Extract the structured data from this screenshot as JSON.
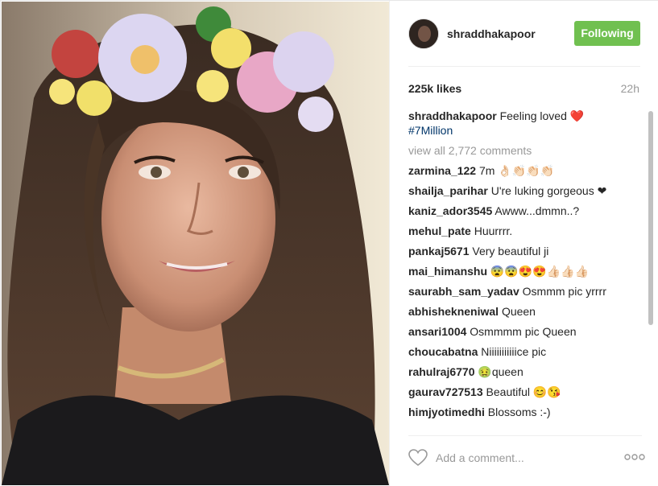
{
  "post": {
    "username": "shraddhakapoor",
    "follow_label": "Following",
    "likes": "225k likes",
    "time": "22h",
    "caption_author": "shraddhakapoor",
    "caption_text": "Feeling loved",
    "caption_heart": "❤️",
    "caption_hashtag": "#7Million",
    "view_all": "view all 2,772 comments"
  },
  "comments": [
    {
      "author": "zarmina_122",
      "text": "7m 👌🏻👏🏻👏🏻👏🏻"
    },
    {
      "author": "shailja_parihar",
      "text": "U're luking gorgeous ❤"
    },
    {
      "author": "kaniz_ador3545",
      "text": "Awww...dmmn..?"
    },
    {
      "author": "mehul_pate",
      "text": "Huurrrr."
    },
    {
      "author": "pankaj5671",
      "text": "Very beautiful ji"
    },
    {
      "author": "mai_himanshu",
      "text": "😨😨😍😍👍🏻👍🏻👍🏻"
    },
    {
      "author": "saurabh_sam_yadav",
      "text": "Osmmm pic yrrrr"
    },
    {
      "author": "abhishekneniwal",
      "text": "Queen"
    },
    {
      "author": "ansari1004",
      "text": "Osmmmm pic Queen"
    },
    {
      "author": "choucabatna",
      "text": "Niiiiiiiiiiice pic"
    },
    {
      "author": "rahulraj6770",
      "text": "🤢queen"
    },
    {
      "author": "gaurav727513",
      "text": "Beautiful 😊😘"
    },
    {
      "author": "himjyotimedhi",
      "text": "Blossoms :-)"
    }
  ],
  "footer": {
    "comment_placeholder": "Add a comment...",
    "more_label": "ooo"
  },
  "icons": {
    "like": "heart-outline-icon",
    "more": "ellipsis-icon"
  },
  "colors": {
    "follow_bg": "#70c050",
    "hashtag": "#003569",
    "muted": "#999999",
    "heart": "#e0163a"
  }
}
